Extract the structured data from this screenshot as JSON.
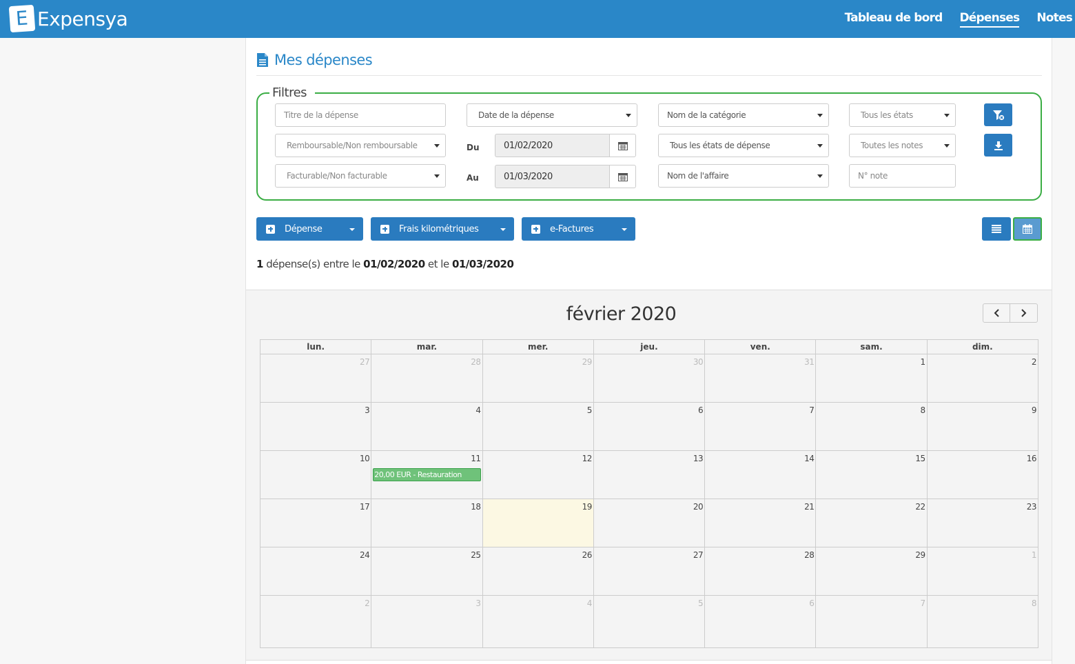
{
  "app": {
    "name": "Expensya",
    "logo_letter": "E"
  },
  "nav": {
    "items": [
      {
        "label": "Tableau de bord",
        "active": false
      },
      {
        "label": "Dépenses",
        "active": true
      },
      {
        "label": "Notes",
        "active": false
      }
    ]
  },
  "page": {
    "title": "Mes dépenses"
  },
  "filters": {
    "legend": "Filtres",
    "title_placeholder": "Titre de la dépense",
    "date_select": "Date de la dépense",
    "category_select": "Nom de la catégorie",
    "states_select": "Tous les états",
    "refundable_select": "Remboursable/Non remboursable",
    "from_label": "Du",
    "from_date": "01/02/2020",
    "expense_states_select": "Tous les états de dépense",
    "notes_select": "Toutes les notes",
    "billable_select": "Facturable/Non facturable",
    "to_label": "Au",
    "to_date": "01/03/2020",
    "affair_select": "Nom de l'affaire",
    "note_number_placeholder": "N° note"
  },
  "actions": {
    "expense": "Dépense",
    "mileage": "Frais kilométriques",
    "einvoices": "e-Factures"
  },
  "summary": {
    "count": "1",
    "text1": " dépense(s) entre le ",
    "start": "01/02/2020",
    "text2": " et le ",
    "end": "01/03/2020"
  },
  "calendar": {
    "month_label": "février 2020",
    "weekdays": [
      "lun.",
      "mar.",
      "mer.",
      "jeu.",
      "ven.",
      "sam.",
      "dim."
    ],
    "weeks": [
      [
        {
          "d": "27",
          "o": true
        },
        {
          "d": "28",
          "o": true
        },
        {
          "d": "29",
          "o": true
        },
        {
          "d": "30",
          "o": true
        },
        {
          "d": "31",
          "o": true
        },
        {
          "d": "1"
        },
        {
          "d": "2"
        }
      ],
      [
        {
          "d": "3"
        },
        {
          "d": "4"
        },
        {
          "d": "5"
        },
        {
          "d": "6"
        },
        {
          "d": "7"
        },
        {
          "d": "8"
        },
        {
          "d": "9"
        }
      ],
      [
        {
          "d": "10"
        },
        {
          "d": "11",
          "event": "20,00 EUR - Restauration"
        },
        {
          "d": "12"
        },
        {
          "d": "13"
        },
        {
          "d": "14"
        },
        {
          "d": "15"
        },
        {
          "d": "16"
        }
      ],
      [
        {
          "d": "17"
        },
        {
          "d": "18"
        },
        {
          "d": "19",
          "today": true
        },
        {
          "d": "20"
        },
        {
          "d": "21"
        },
        {
          "d": "22"
        },
        {
          "d": "23"
        }
      ],
      [
        {
          "d": "24"
        },
        {
          "d": "25"
        },
        {
          "d": "26"
        },
        {
          "d": "27"
        },
        {
          "d": "28"
        },
        {
          "d": "29"
        },
        {
          "d": "1",
          "o": true
        }
      ],
      [
        {
          "d": "2",
          "o": true
        },
        {
          "d": "3",
          "o": true
        },
        {
          "d": "4",
          "o": true
        },
        {
          "d": "5",
          "o": true
        },
        {
          "d": "6",
          "o": true
        },
        {
          "d": "7",
          "o": true
        },
        {
          "d": "8",
          "o": true
        }
      ]
    ]
  },
  "colors": {
    "brand": "#2a87c8",
    "button": "#2a7bbf",
    "filter_border": "#3aad44",
    "event": "#6fc27a",
    "today": "#fcf8e3"
  }
}
